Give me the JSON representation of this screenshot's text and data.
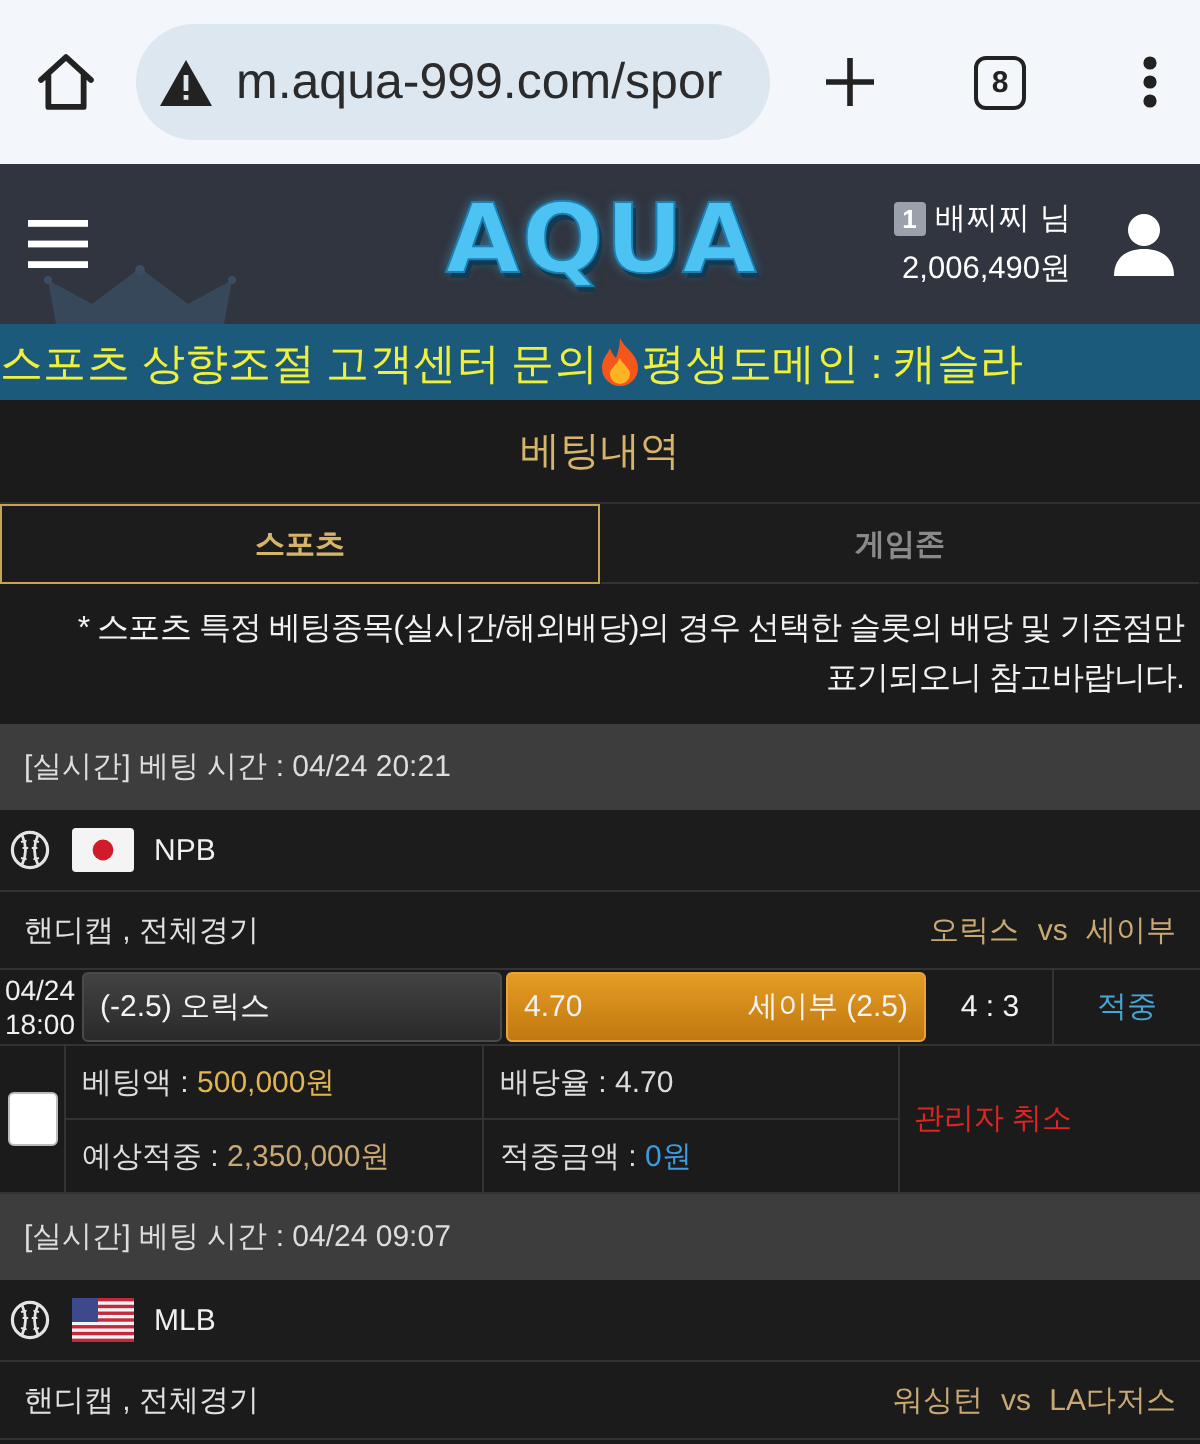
{
  "browser": {
    "url": "m.aqua-999.com/spor",
    "tab_count": "8"
  },
  "header": {
    "logo": "AQUA",
    "user_level": "1",
    "user_name": "배찌찌 님",
    "balance": "2,006,490원"
  },
  "ticker": {
    "segments": [
      "스포츠 상향조절 고객센터 문의",
      "평생도메인 : 캐슬라"
    ]
  },
  "page_title": "베팅내역",
  "tabs": [
    {
      "label": "스포츠",
      "selected": true
    },
    {
      "label": "게임존",
      "selected": false
    }
  ],
  "notice": "* 스포츠 특정 베팅종목(실시간/해외배당)의 경우 선택한 슬롯의 배당 및 기준점만 표기되오니 참고바랍니다.",
  "bets": [
    {
      "header": "[실시간] 베팅 시간 : 04/24 20:21",
      "flag": {
        "kind": "japan"
      },
      "league": "NPB",
      "market": "핸디캡 , 전체경기",
      "teams": "오릭스 vs 세이부",
      "pick": {
        "date": "04/24",
        "time": "18:00",
        "options": [
          {
            "label": "(-2.5) 오릭스",
            "selected": false
          },
          {
            "odds": "4.70",
            "label": "세이부 (2.5)",
            "selected": true
          }
        ],
        "score": "4 : 3",
        "result": "적중"
      },
      "details": {
        "checked": false,
        "items": [
          {
            "kind": "stake",
            "label": "베팅액 :",
            "value": "500,000원"
          },
          {
            "kind": "odds",
            "label": "배당율 :",
            "value": "4.70"
          },
          {
            "kind": "expected",
            "label": "예상적중 :",
            "value": "2,350,000원"
          },
          {
            "kind": "win",
            "label": "적중금액 :",
            "value": "0원"
          }
        ],
        "status": "관리자 취소"
      }
    },
    {
      "header": "[실시간] 베팅 시간 : 04/24 09:07",
      "flag": {
        "kind": "usa"
      },
      "league": "MLB",
      "market": "핸디캡 , 전체경기",
      "teams": "워싱턴 vs LA다저스"
    }
  ]
}
